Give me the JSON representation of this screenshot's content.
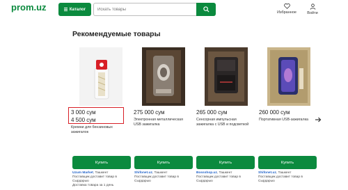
{
  "header": {
    "logo": "prom.uz",
    "catalog_label": "Каталог",
    "search_placeholder": "Искать товары",
    "favorites_label": "Избранное",
    "login_label": "Войти"
  },
  "section": {
    "title": "Рекомендуемые товары"
  },
  "products": [
    {
      "price": "3 000 сум",
      "price2": "4 500 сум",
      "title": "Кремни для бензиновых зажигалок",
      "seller": "Uzum Market",
      "city": ", Ташкент",
      "note1": "Поставщик доставит товар в Сырдарью",
      "note2": "Доставка товара за 1 день"
    },
    {
      "price": "275 000 сум",
      "title": "Электронная металлическая USB зажигалка",
      "seller": "Shifonet.uz",
      "city": ", Ташкент",
      "note1": "Поставщик доставит товар в Сырдарью"
    },
    {
      "price": "265 000 сум",
      "title": "Сенсорная импульсная зажигалка с USB и подсветкой",
      "seller": "Bossshop.uz",
      "city": ", Ташкент",
      "note1": "Поставщик доставит товар в Сырдарью"
    },
    {
      "price": "260 000 сум",
      "title": "Портативная USB-зажигалка",
      "seller": "Shifonet.uz",
      "city": ", Ташкент",
      "note1": "Поставщик доставит товар в Сырдарью"
    }
  ],
  "buy_label": "Купить",
  "colors": {
    "brand_green": "#0b8a3e",
    "highlight_red": "#d81f26",
    "seller_blue": "#2364c9"
  },
  "icons": [
    "menu-icon",
    "search-icon",
    "heart-icon",
    "user-icon",
    "chevron-right-icon"
  ]
}
